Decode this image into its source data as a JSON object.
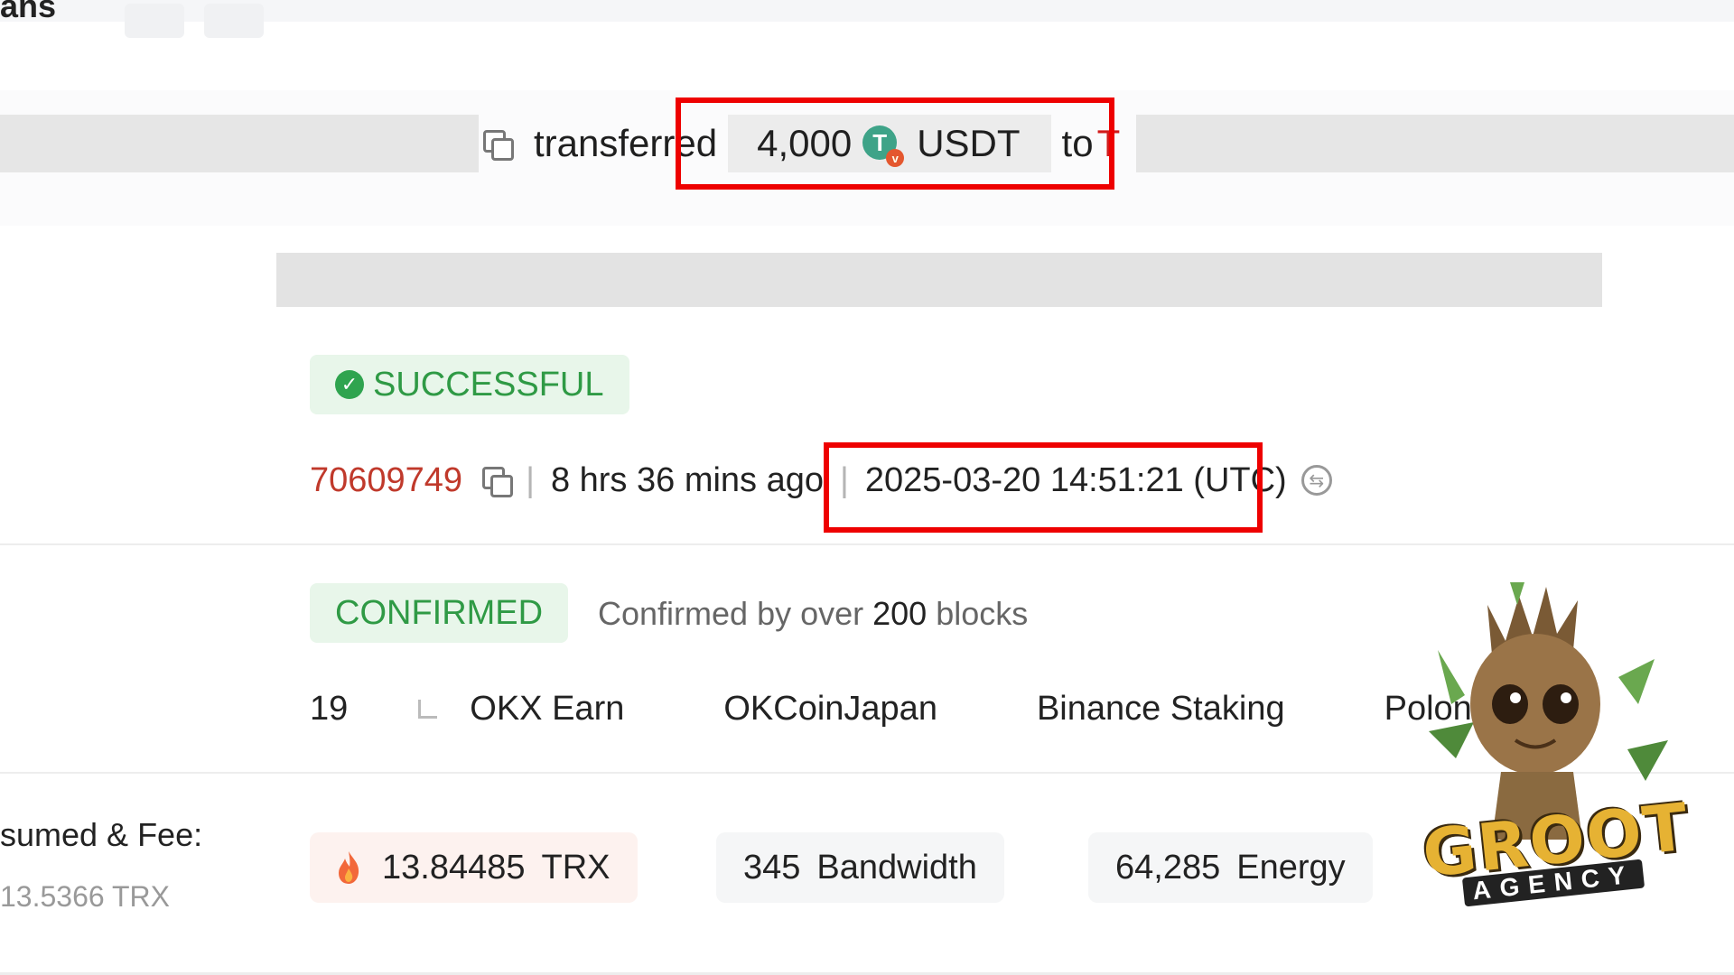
{
  "header": {
    "title_fragment": "ans"
  },
  "summary": {
    "verb": "transferred",
    "amount": "4,000",
    "token": "USDT",
    "to_word": "to",
    "to_fragment": "T",
    "token_icon_letter": "T",
    "token_badge_letter": "v"
  },
  "status": {
    "label": "SUCCESSFUL"
  },
  "meta": {
    "block": "70609749",
    "age": "8 hrs 36 mins ago",
    "timestamp": "2025-03-20 14:51:21 (UTC)"
  },
  "confirmation": {
    "label": "CONFIRMED",
    "text_prefix": "Confirmed by over",
    "count": "200",
    "text_suffix": "blocks"
  },
  "super_representatives": {
    "count": "19",
    "items": [
      "OKX Earn",
      "OKCoinJapan",
      "Binance Staking",
      "Poloniex"
    ]
  },
  "fees": {
    "label": "sumed & Fee:",
    "total": "13.5366 TRX",
    "burn_amount": "13.84485",
    "burn_unit": "TRX",
    "bandwidth_amount": "345",
    "bandwidth_unit": "Bandwidth",
    "energy_amount": "64,285",
    "energy_unit": "Energy"
  },
  "watermark": {
    "brand": "GROOT",
    "sub": "AGENCY"
  },
  "colors": {
    "highlight": "#ee0000",
    "success": "#2f9a45",
    "block_link": "#c0392b",
    "usdt": "#3ea388"
  },
  "icons": [
    "copy-icon",
    "usdt-icon",
    "check-icon",
    "refresh-icon",
    "corner-icon",
    "chevron-down-icon",
    "fire-icon"
  ]
}
